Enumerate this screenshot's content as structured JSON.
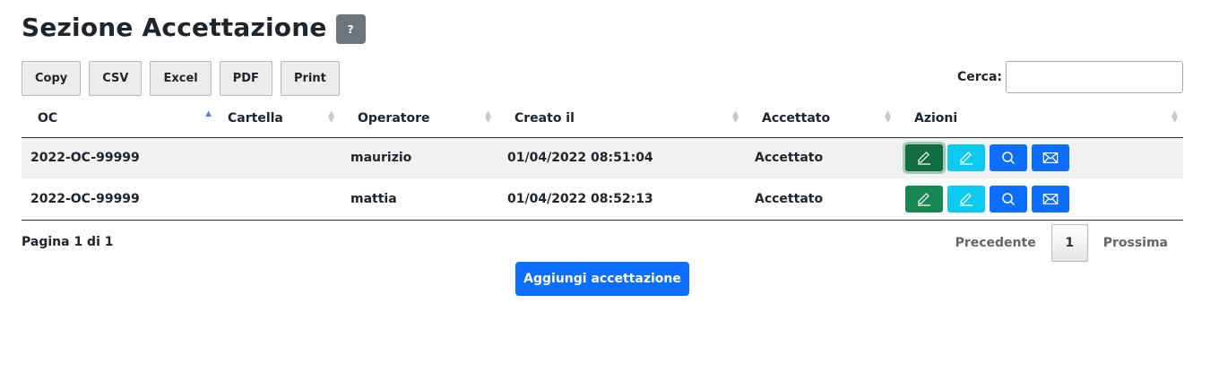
{
  "header": {
    "title": "Sezione Accettazione",
    "help_label": "?"
  },
  "toolbar": {
    "buttons": [
      "Copy",
      "CSV",
      "Excel",
      "PDF",
      "Print"
    ]
  },
  "search": {
    "label": "Cerca:",
    "value": ""
  },
  "table": {
    "columns": [
      "OC",
      "Cartella",
      "Operatore",
      "Creato il",
      "Accettato",
      "Azioni"
    ],
    "sorted_column": "OC",
    "sort_direction": "asc",
    "rows": [
      {
        "oc": "2022-OC-99999",
        "cartella": "",
        "operatore": "maurizio",
        "creato_il": "01/04/2022 08:51:04",
        "accettato": "Accettato"
      },
      {
        "oc": "2022-OC-99999",
        "cartella": "",
        "operatore": "mattia",
        "creato_il": "01/04/2022 08:52:13",
        "accettato": "Accettato"
      }
    ],
    "row_actions": [
      "pencil-icon",
      "pencil-icon",
      "search-icon",
      "envelope-icon"
    ]
  },
  "footer": {
    "info": "Pagina 1 di 1"
  },
  "pagination": {
    "previous": "Precedente",
    "current": "1",
    "next": "Prossima"
  },
  "add_button": {
    "label": "Aggiungi accettazione"
  },
  "colors": {
    "primary": "#0d6efd",
    "success": "#198754",
    "info": "#0dcaf0",
    "secondary": "#6c757d"
  }
}
